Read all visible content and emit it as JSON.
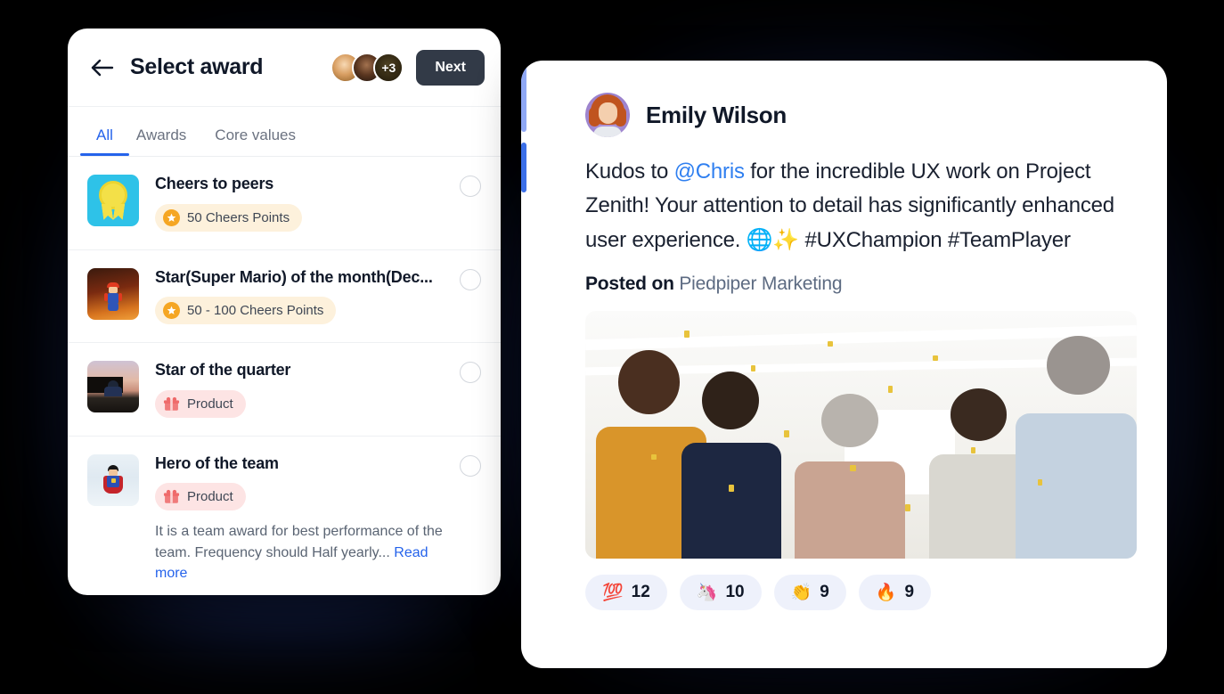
{
  "background_color": "#000000",
  "left_panel": {
    "back_icon": "arrow-left-icon",
    "title": "Select award",
    "avatars": [
      {
        "name": "avatar-1",
        "label": ""
      },
      {
        "name": "avatar-2",
        "label": ""
      },
      {
        "name": "avatar-3",
        "label": "+3"
      }
    ],
    "next_label": "Next",
    "tabs": [
      {
        "label": "All",
        "active": true
      },
      {
        "label": "Awards",
        "active": false
      },
      {
        "label": "Core values",
        "active": false
      }
    ],
    "awards": [
      {
        "thumb": "medal-rosette-icon",
        "name": "Cheers to peers",
        "pill_label": "50 Cheers Points",
        "pill_type": "points",
        "pill_icon": "star-coin-icon",
        "description": "",
        "read_more": "",
        "selected": false
      },
      {
        "thumb": "mario-figure-image",
        "name": "Star(Super Mario) of the month(Dec...",
        "pill_label": "50 - 100 Cheers Points",
        "pill_type": "points",
        "pill_icon": "star-coin-icon",
        "description": "",
        "read_more": "",
        "selected": false
      },
      {
        "thumb": "sunset-silhouette-image",
        "name": "Star of the quarter",
        "pill_label": "Product",
        "pill_type": "product",
        "pill_icon": "gift-icon",
        "description": "",
        "read_more": "",
        "selected": false
      },
      {
        "thumb": "superman-figure-image",
        "name": "Hero of the team",
        "pill_label": "Product",
        "pill_type": "product",
        "pill_icon": "gift-icon",
        "description": "It is a team award for best performance of the team. Frequency should Half yearly... ",
        "read_more": "Read more",
        "selected": false
      }
    ]
  },
  "right_panel": {
    "author": "Emily Wilson",
    "avatar": "author-avatar",
    "accent_top_color": "#8fa8f5",
    "accent_bottom_color": "#3b6fe8",
    "post": {
      "part1": "Kudos to ",
      "mention": "@Chris",
      "part2": " for the incredible UX work on Project Zenith! Your attention to detail has significantly enhanced user experience. 🌐✨ #UXChampion #TeamPlayer"
    },
    "posted_on_label": "Posted on",
    "posted_on_org": "Piedpiper Marketing",
    "photo_alt": "celebration-photo",
    "reactions": [
      {
        "emoji": "💯",
        "name": "hundred-points-emoji",
        "count": "12"
      },
      {
        "emoji": "🦄",
        "name": "unicorn-emoji",
        "count": "10"
      },
      {
        "emoji": "👏",
        "name": "clapping-hands-emoji",
        "count": "9"
      },
      {
        "emoji": "🔥",
        "name": "fire-emoji",
        "count": "9"
      }
    ]
  }
}
